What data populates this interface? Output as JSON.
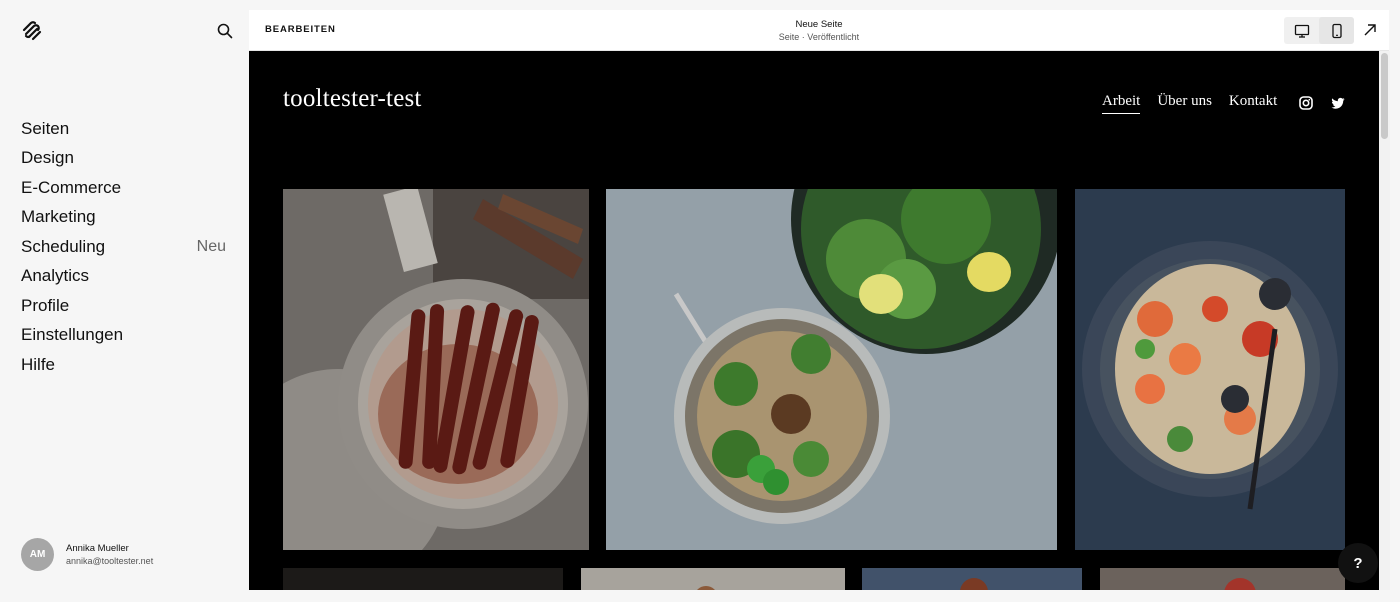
{
  "sidebar": {
    "logo": "squarespace-logo-icon",
    "search_icon": "search-icon",
    "items": [
      {
        "label": "Seiten"
      },
      {
        "label": "Design"
      },
      {
        "label": "E-Commerce"
      },
      {
        "label": "Marketing"
      },
      {
        "label": "Scheduling",
        "badge": "Neu"
      },
      {
        "label": "Analytics"
      },
      {
        "label": "Profile"
      },
      {
        "label": "Einstellungen"
      },
      {
        "label": "Hilfe"
      }
    ],
    "user": {
      "initials": "AM",
      "name": "Annika Mueller",
      "email": "annika@tooltester.net"
    }
  },
  "topbar": {
    "edit_label": "BEARBEITEN",
    "page_title": "Neue Seite",
    "page_status": "Seite · Veröffentlicht",
    "icons": [
      "desktop-icon",
      "mobile-icon",
      "expand-icon"
    ]
  },
  "site": {
    "title": "tooltester-test",
    "nav": [
      {
        "label": "Arbeit",
        "active": true
      },
      {
        "label": "Über uns",
        "active": false
      },
      {
        "label": "Kontakt",
        "active": false
      }
    ],
    "social_icons": [
      "instagram-icon",
      "twitter-icon"
    ],
    "gallery": [
      "sausages-in-pan",
      "pho-soup-bowl",
      "seafood-pasta-plate"
    ]
  },
  "help_label": "?",
  "colors": {
    "sidebar_bg": "#f6f6f6",
    "preview_bg": "#000000",
    "avatar_bg": "#a6a6a6",
    "text": "#111111"
  }
}
